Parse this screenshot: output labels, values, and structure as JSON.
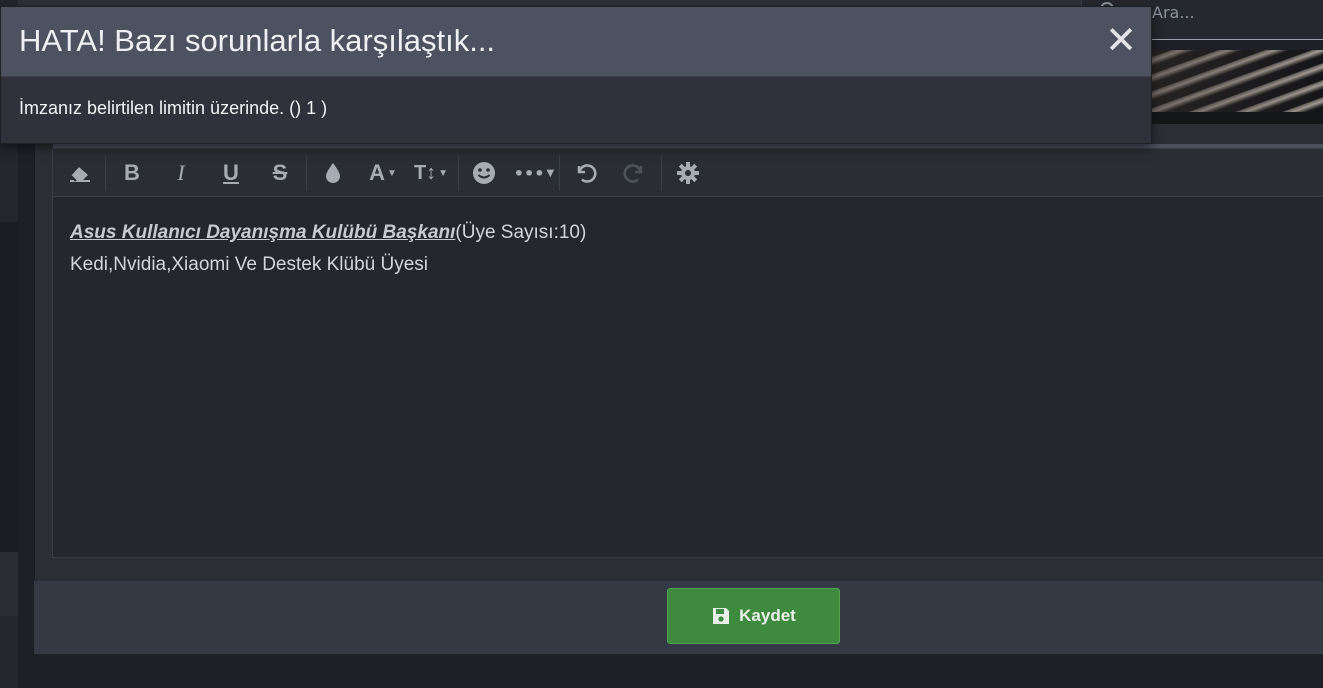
{
  "modal": {
    "title": "HATA! Bazı sorunlarla karşılaştık...",
    "close_symbol": "✕",
    "message": "İmzanız belirtilen limitin üzerinde. () 1 )"
  },
  "search": {
    "placeholder": "Ara..."
  },
  "editor": {
    "toolbar": [
      {
        "name": "eraser-icon",
        "label": "⌫"
      },
      {
        "name": "bold-icon",
        "label": "B"
      },
      {
        "name": "italic-icon",
        "label": "I"
      },
      {
        "name": "underline-icon",
        "label": "U"
      },
      {
        "name": "strikethrough-icon",
        "label": "S"
      },
      {
        "name": "text-color-icon",
        "label": "💧"
      },
      {
        "name": "font-family-icon",
        "label": "A"
      },
      {
        "name": "font-size-icon",
        "label": "T↕"
      },
      {
        "name": "emoji-icon",
        "label": "☻"
      },
      {
        "name": "more-options-icon",
        "label": "•••"
      },
      {
        "name": "undo-icon",
        "label": "↶"
      },
      {
        "name": "redo-icon",
        "label": "↷"
      },
      {
        "name": "settings-icon",
        "label": "⚙"
      }
    ],
    "content": {
      "line1_emphasis": "Asus Kullanıcı Dayanışma Kulübü Başkanı",
      "line1_rest": "(Üye Sayısı:10)",
      "line2": "Kedi,Nvidia,Xiaomi Ve Destek Klübü Üyesi"
    }
  },
  "footer": {
    "save_label": "Kaydet"
  },
  "colors": {
    "modal_header": "#4d5261",
    "save_button": "#3e8a3f",
    "editor_bg": "#24272d"
  }
}
